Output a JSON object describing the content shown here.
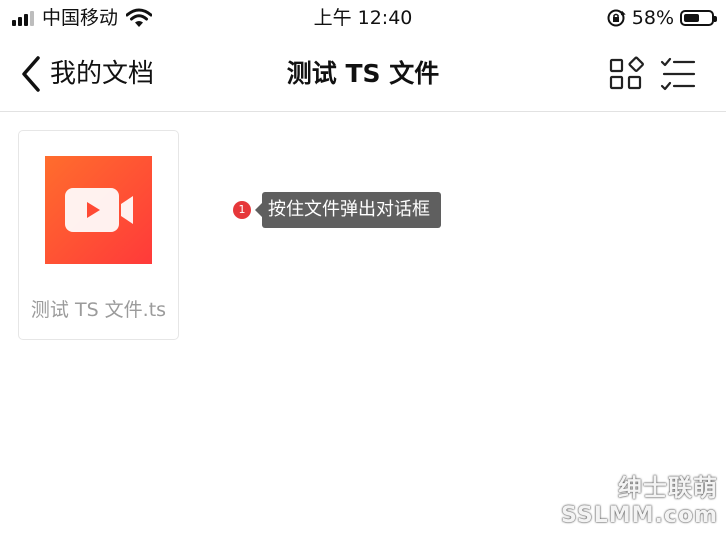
{
  "status_bar": {
    "carrier": "中国移动",
    "time": "上午 12:40",
    "battery_percent": "58%",
    "battery_level": 0.58,
    "signal_icon": "cellular-signal-icon",
    "wifi_icon": "wifi-icon",
    "rotation_lock_icon": "rotation-lock-icon"
  },
  "nav": {
    "back_label": "我的文档",
    "title": "测试 TS 文件",
    "back_icon": "chevron-left-icon",
    "grid_view_icon": "grid-view-icon",
    "select_list_icon": "checklist-icon"
  },
  "files": [
    {
      "name": "测试 TS 文件.ts",
      "thumbnail_icon": "video-camera-icon",
      "thumbnail_colors": [
        "#ff6d2d",
        "#ff3a3a"
      ]
    }
  ],
  "annotation": {
    "number": "1",
    "text": "按住文件弹出对话框"
  },
  "watermark": {
    "line1": "绅士联萌",
    "line2": "SSLMM.com"
  },
  "colors": {
    "accent_red": "#e6373a",
    "tooltip_bg": "#5f5f5f",
    "file_name_text": "#9b9b9b"
  }
}
